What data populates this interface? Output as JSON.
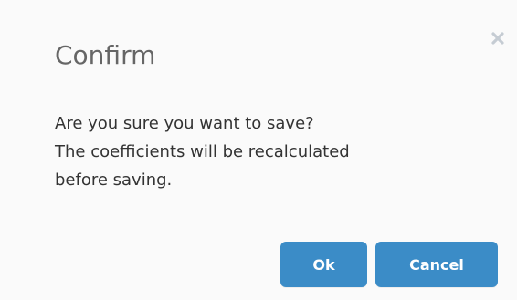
{
  "dialog": {
    "title": "Confirm",
    "message_lines": [
      "Are you sure you want to save?",
      "The coefficients will be recalculated",
      "before saving."
    ],
    "close_icon": "close-icon",
    "ok_label": "Ok",
    "cancel_label": "Cancel"
  },
  "colors": {
    "button_bg": "#3b8cc7",
    "button_text": "#ffffff",
    "title_text": "#666666",
    "body_text": "#333333",
    "close_icon": "#c5ccd3",
    "background": "#fafafa"
  }
}
